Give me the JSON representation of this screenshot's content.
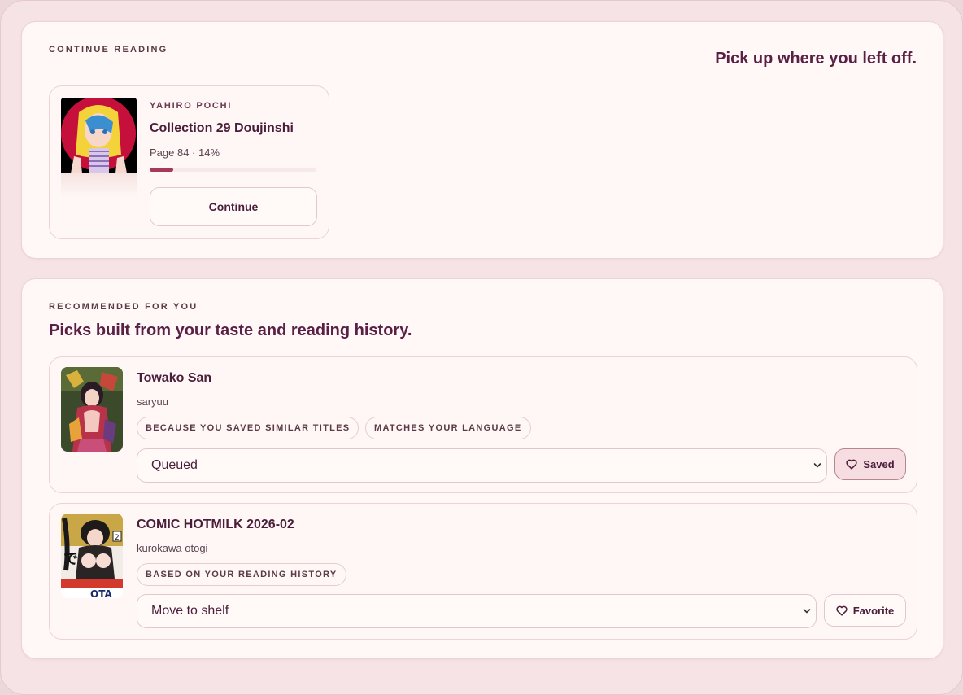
{
  "continue_reading": {
    "eyebrow": "CONTINUE READING",
    "headline": "Pick up where you left off.",
    "card": {
      "author": "YAHIRO POCHI",
      "title": "Collection 29 Doujinshi",
      "progress_text": "Page 84 · 14%",
      "progress_fraction": 0.14,
      "button_label": "Continue"
    }
  },
  "recommended": {
    "eyebrow": "RECOMMENDED FOR YOU",
    "headline": "Picks built from your taste and reading history.",
    "items": [
      {
        "title": "Towako San",
        "author": "saryuu",
        "reasons": [
          "BECAUSE YOU SAVED SIMILAR TITLES",
          "MATCHES YOUR LANGUAGE"
        ],
        "shelf_value": "Queued",
        "favorite_label": "Saved",
        "favorite_state": "saved"
      },
      {
        "title": "COMIC HOTMILK 2026-02",
        "author": "kurokawa otogi",
        "reasons": [
          "BASED ON YOUR READING HISTORY"
        ],
        "shelf_value": "Move to shelf",
        "favorite_label": "Favorite",
        "favorite_state": "not-saved"
      }
    ]
  },
  "colors": {
    "accent": "#a6385d",
    "heading": "#5a1f45",
    "panel_bg": "#fff8f6",
    "page_bg": "#f6e3e6"
  },
  "icons": {
    "favorite": "heart-outline-icon",
    "select": "chevron-down-icon"
  }
}
